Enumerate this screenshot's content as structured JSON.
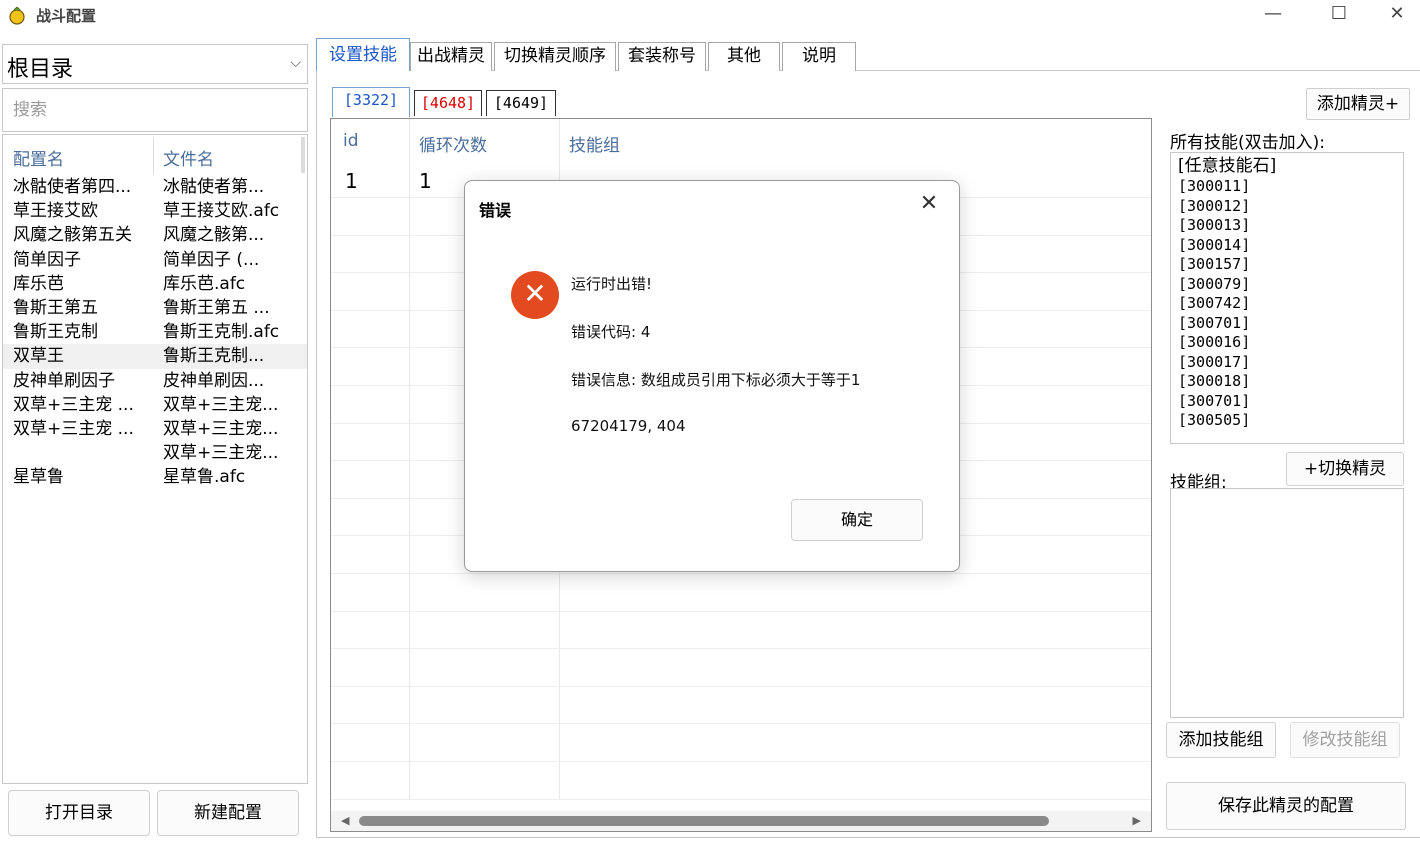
{
  "window": {
    "title": "战斗配置",
    "min_glyph": "—",
    "max_glyph": "☐",
    "close_glyph": "✕"
  },
  "left": {
    "root_combo": "根目录",
    "root_combo_chevron": "⌵",
    "search_placeholder": "搜索",
    "columns": {
      "name": "配置名",
      "file": "文件名"
    },
    "rows": [
      {
        "name": "冰骷使者第四...",
        "file": "冰骷使者第..."
      },
      {
        "name": "草王接艾欧",
        "file": "草王接艾欧.afc"
      },
      {
        "name": "风魔之骸第五关",
        "file": "风魔之骸第..."
      },
      {
        "name": "简单因子",
        "file": "简单因子 (..."
      },
      {
        "name": "库乐芭",
        "file": "库乐芭.afc"
      },
      {
        "name": "鲁斯王第五",
        "file": "鲁斯王第五 ..."
      },
      {
        "name": "鲁斯王克制",
        "file": "鲁斯王克制.afc"
      },
      {
        "name": "双草王",
        "file": "鲁斯王克制...",
        "selected": true
      },
      {
        "name": "皮神单刷因子",
        "file": "皮神单刷因..."
      },
      {
        "name": "双草+三主宠 ...",
        "file": "双草+三主宠..."
      },
      {
        "name": "双草+三主宠 ...",
        "file": "双草+三主宠..."
      },
      {
        "name": "",
        "file": "双草+三主宠..."
      },
      {
        "name": "星草鲁",
        "file": "星草鲁.afc"
      }
    ],
    "open_dir": "打开目录",
    "new_config": "新建配置"
  },
  "tabs": [
    "设置技能",
    "出战精灵",
    "切换精灵顺序",
    "套装称号",
    "其他",
    "说明"
  ],
  "subtabs": [
    "[3322]",
    "[4648]",
    "[4649]"
  ],
  "add_spirit": "添加精灵+",
  "grid": {
    "columns": [
      "id",
      "循环次数",
      "技能组"
    ],
    "rows": [
      {
        "id": "1",
        "loop": "1",
        "group": ""
      }
    ]
  },
  "right": {
    "all_skills_label": "所有技能(双击加入):",
    "skills": [
      "[任意技能石]",
      "[300011]",
      "[300012]",
      "[300013]",
      "[300014]",
      "[300157]",
      "[300079]",
      "[300742]",
      "[300701]",
      "[300016]",
      "[300017]",
      "[300018]",
      "[300701]",
      "[300505]"
    ],
    "skill_group_label": "技能组:",
    "switch_spirit": "+切换精灵",
    "add_group": "添加技能组",
    "edit_group": "修改技能组",
    "save": "保存此精灵的配置"
  },
  "dialog": {
    "title": "错误",
    "close_glyph": "✕",
    "icon_glyph": "✕",
    "line1": "运行时出错!",
    "line2": "错误代码: 4",
    "line3": "错误信息: 数组成员引用下标必须大于等于1",
    "line4": "67204179, 404",
    "ok": "确定"
  },
  "colors": {
    "accent_tab": "#1a56c9",
    "red_subtab": "#e00000",
    "error_icon": "#e34a1f",
    "header_text": "#4a6d9c"
  }
}
